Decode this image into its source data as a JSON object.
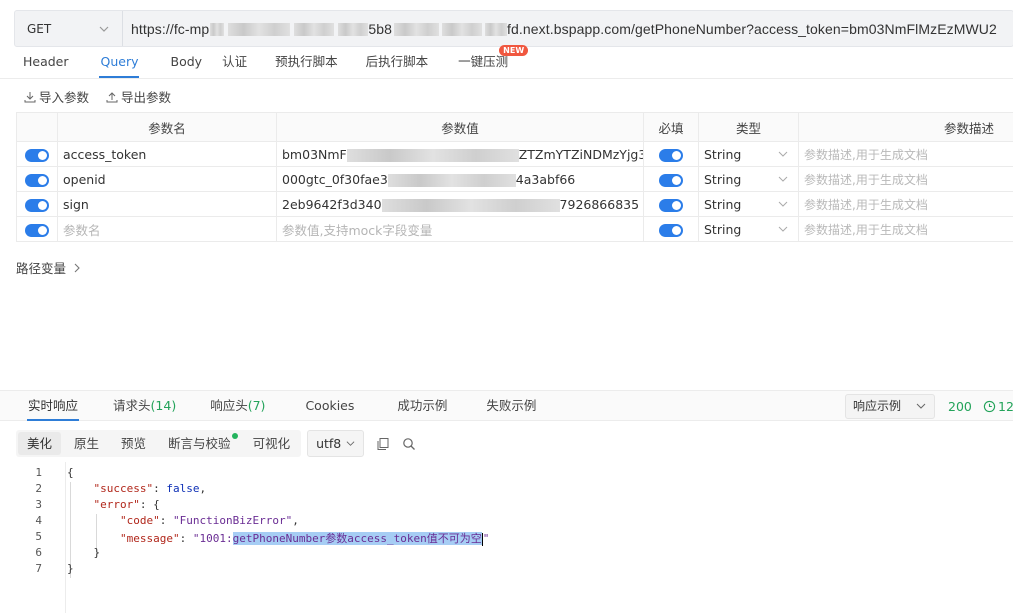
{
  "request": {
    "method": "GET",
    "url_prefix": "https://fc-mp",
    "url_mid1": "5b8",
    "url_suffix": "fd.next.bspapp.com/getPhoneNumber?access_token=bm03NmFlMzEzMWU2"
  },
  "tabs": [
    {
      "label": "Header"
    },
    {
      "label": "Query"
    },
    {
      "label": "Body"
    },
    {
      "label": "认证"
    },
    {
      "label": "预执行脚本"
    },
    {
      "label": "后执行脚本"
    },
    {
      "label": "一键压测"
    }
  ],
  "new_badge": "NEW",
  "tools": {
    "import_label": "导入参数",
    "export_label": "导出参数"
  },
  "table": {
    "headers": [
      "参数名",
      "参数值",
      "必填",
      "类型",
      "参数描述"
    ],
    "rows": [
      {
        "name": "access_token",
        "value_a": "bm03NmF",
        "value_b": "ZTZmYTZiNDMzYjg3",
        "type": "String",
        "desc": "参数描述,用于生成文档"
      },
      {
        "name": "openid",
        "value_a": "000gtc_0f30fae3",
        "value_b": "4a3abf66",
        "type": "String",
        "desc": "参数描述,用于生成文档"
      },
      {
        "name": "sign",
        "value_a": "2eb9642f3d340",
        "value_b": "7926866835",
        "type": "String",
        "desc": "参数描述,用于生成文档"
      },
      {
        "name": "参数名",
        "value_a": "参数值,支持mock字段变量",
        "value_b": "",
        "type": "String",
        "desc": "参数描述,用于生成文档"
      }
    ]
  },
  "path_vars_label": "路径变量",
  "response_tabs": [
    {
      "label": "实时响应",
      "count": ""
    },
    {
      "label": "请求头",
      "count": "(14)"
    },
    {
      "label": "响应头",
      "count": "(7)"
    },
    {
      "label": "Cookies",
      "count": ""
    },
    {
      "label": "成功示例",
      "count": ""
    },
    {
      "label": "失败示例",
      "count": ""
    }
  ],
  "response_example_label": "响应示例",
  "status_code": "200",
  "time_partial": "12",
  "view_modes": [
    "美化",
    "原生",
    "预览",
    "断言与校验",
    "可视化"
  ],
  "encoding": "utf8",
  "code": {
    "line_numbers": [
      "1",
      "2",
      "3",
      "4",
      "5",
      "6",
      "7"
    ],
    "success_key": "\"success\"",
    "success_val": "false",
    "error_key": "\"error\"",
    "code_key": "\"code\"",
    "code_val": "\"FunctionBizError\"",
    "message_key": "\"message\"",
    "message_prefix": "\"1001:",
    "message_highlight": "getPhoneNumber参数access_token值不可为空",
    "message_end": "\""
  },
  "colors": {
    "accent": "#2e7dd7",
    "toggle": "#2b7de9",
    "success": "#23a35a",
    "badge": "#f0573f"
  }
}
